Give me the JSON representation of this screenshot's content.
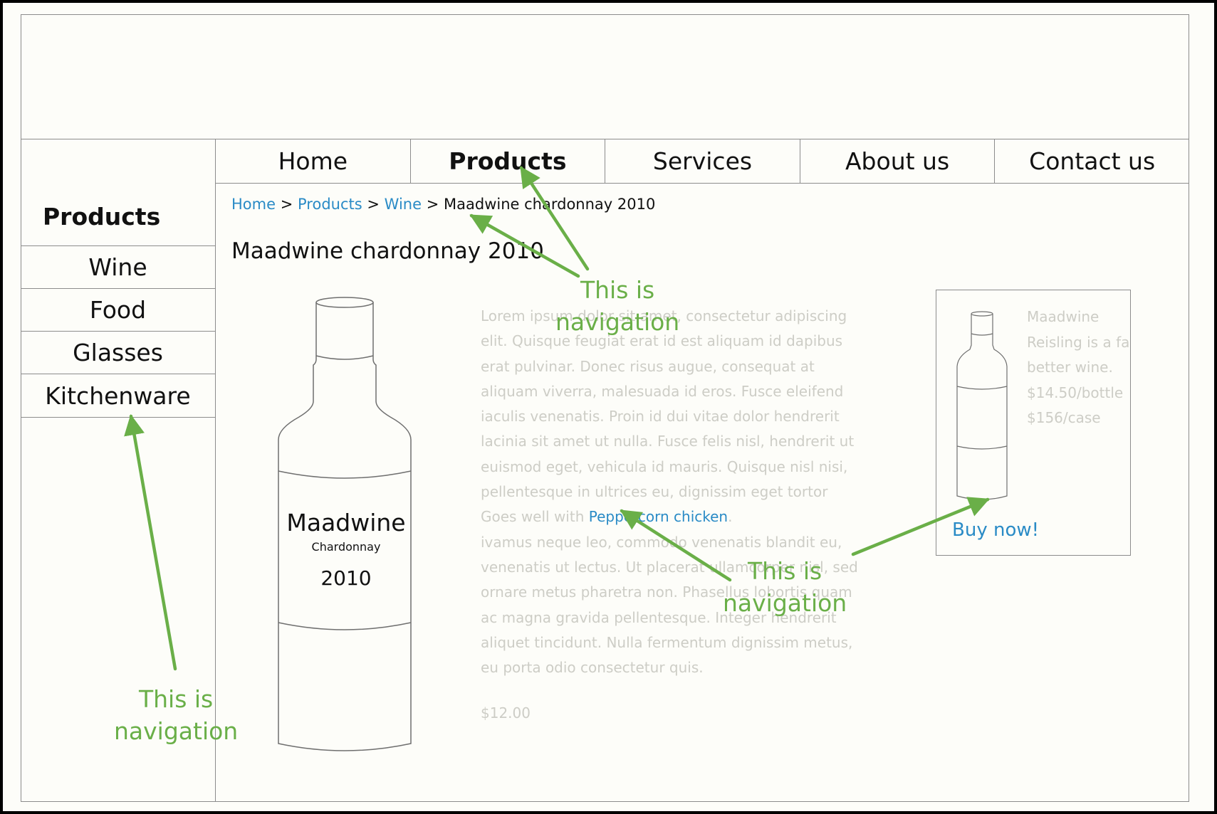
{
  "top_nav": [
    {
      "label": "Home",
      "active": false
    },
    {
      "label": "Products",
      "active": true
    },
    {
      "label": "Services",
      "active": false
    },
    {
      "label": "About us",
      "active": false
    },
    {
      "label": "Contact us",
      "active": false
    }
  ],
  "sidebar": {
    "heading": "Products",
    "items": [
      "Wine",
      "Food",
      "Glasses",
      "Kitchenware"
    ]
  },
  "breadcrumb": {
    "home": "Home",
    "products": "Products",
    "wine": "Wine",
    "current": "Maadwine chardonnay 2010",
    "separator": ">"
  },
  "product": {
    "title": "Maadwine chardonnay 2010",
    "bottle_label": {
      "brand": "Maadwine",
      "variety": "Chardonnay",
      "year": "2010"
    },
    "description": {
      "text1": "Lorem ipsum dolor sit amet, consectetur adipiscing elit. Quisque feugiat erat id est aliquam id dapibus erat pulvinar. Donec risus augue, consequat at aliquam viverra, malesuada id eros. Fusce eleifend iaculis venenatis. Proin id dui vitae dolor hendrerit lacinia sit amet ut nulla. Fusce felis nisl, hendrerit ut euismod eget, vehicula id mauris. Quisque nisl nisi, pellentesque in ultrices eu, dignissim eget tortor",
      "goes_well_with": "Goes well with ",
      "pairing_link": "Peppercorn chicken",
      "period": ".",
      "text2": "ivamus neque leo, commodo venenatis blandit eu, venenatis ut lectus. Ut placerat ullamcorper nisl, sed ornare metus pharetra non. Phasellus lobortis quam ac magna gravida pellentesque. Integer hendrerit aliquet tincidunt. Nulla fermentum dignissim metus, eu porta odio consectetur quis."
    },
    "price": "$12.00"
  },
  "promo": {
    "lines": [
      "Maadwine",
      "Reisling is a far",
      "better wine.",
      "$14.50/bottle",
      "$156/case"
    ],
    "cta": "Buy now!"
  },
  "annotations": {
    "top": [
      "This is",
      "navigation"
    ],
    "middle": [
      "This is",
      "navigation"
    ],
    "left": [
      "This is",
      "navigation"
    ]
  },
  "colors": {
    "link": "#2a8bc6",
    "annotation": "#6aaf48",
    "muted_text": "#cdcdc6",
    "wireframe_line": "#8c8c8c",
    "background": "#fdfdf9"
  }
}
